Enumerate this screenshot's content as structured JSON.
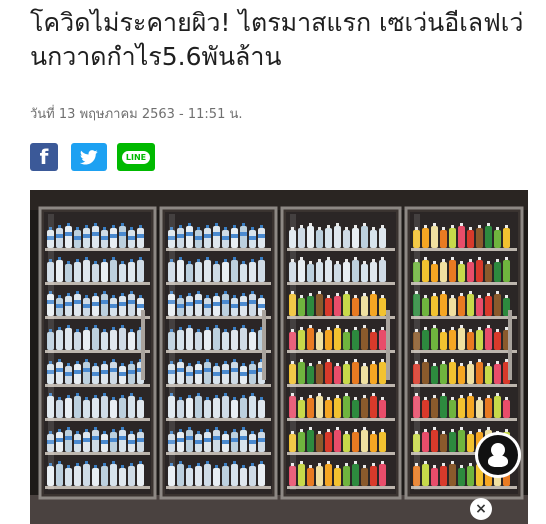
{
  "article": {
    "headline": "โควิดไม่ระคายผิว! ไตรมาสแรก เซเว่นอีเลฟเว่นกวาดกำไร5.6พันล้าน",
    "dateline": "วันที่ 13 พฤษภาคม 2563 - 11:51 น."
  },
  "share": {
    "facebook_icon": "facebook-icon",
    "twitter_icon": "twitter-bird-icon",
    "line_icon": "line-icon",
    "line_label": "LINE"
  },
  "photo": {
    "subject": "convenience-store-drink-refrigerators",
    "close_label": "×"
  },
  "colors": {
    "facebook": "#3b5998",
    "twitter": "#1da1f2",
    "line": "#00b900"
  }
}
